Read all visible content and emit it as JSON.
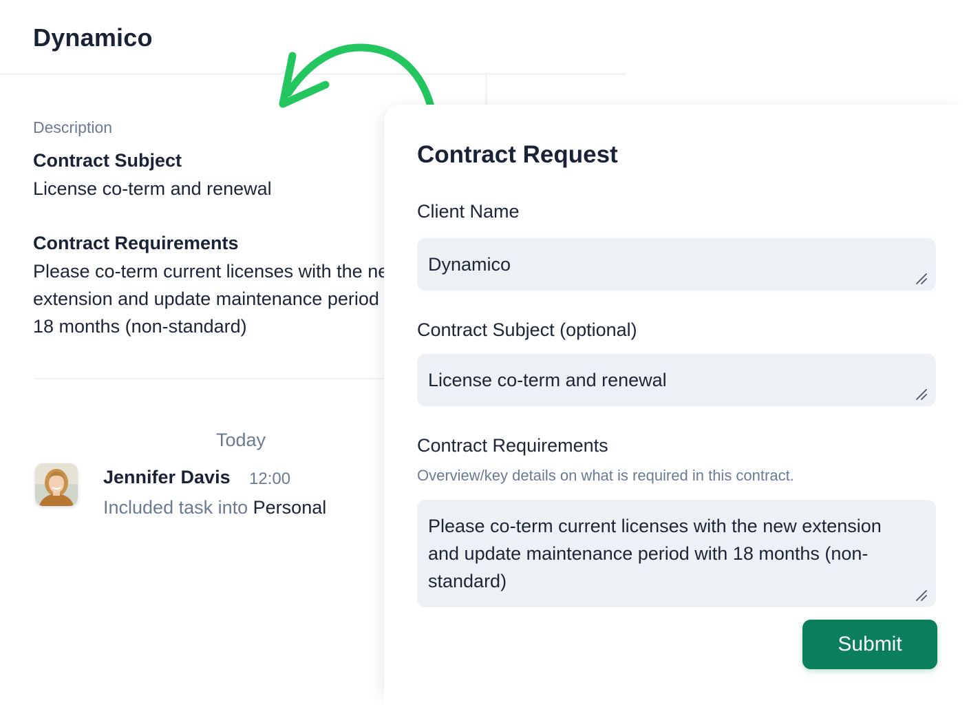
{
  "task": {
    "title": "Dynamico",
    "description_label": "Description",
    "subject_heading": "Contract Subject",
    "subject_text": "License co-term and renewal",
    "requirements_heading": "Contract Requirements",
    "requirements_text": "Please co-term current licenses with the new extension and update maintenance period with 18 months (non-standard)"
  },
  "activity": {
    "date_label": "Today",
    "entries": [
      {
        "name": "Jennifer Davis",
        "time": "12:00",
        "action": "Included task into",
        "target": "Personal"
      }
    ]
  },
  "form": {
    "title": "Contract Request",
    "fields": {
      "client_name": {
        "label": "Client Name",
        "value": "Dynamico"
      },
      "contract_subject": {
        "label": "Contract Subject (optional)",
        "value": "License co-term and renewal"
      },
      "contract_requirements": {
        "label": "Contract Requirements",
        "help": "Overview/key details on what is required in this contract.",
        "value": "Please co-term current licenses with the new extension and update maintenance period with 18 months (non-standard)"
      }
    },
    "submit_label": "Submit"
  },
  "colors": {
    "accent_green": "#0b7f5c",
    "arrow_green": "#22c55e",
    "field_background": "#edf0f5",
    "muted_text": "#6b7a93"
  },
  "icons": {
    "resize": "resize-handle-icon",
    "arrow": "curved-arrow-icon",
    "avatar": "user-avatar"
  }
}
